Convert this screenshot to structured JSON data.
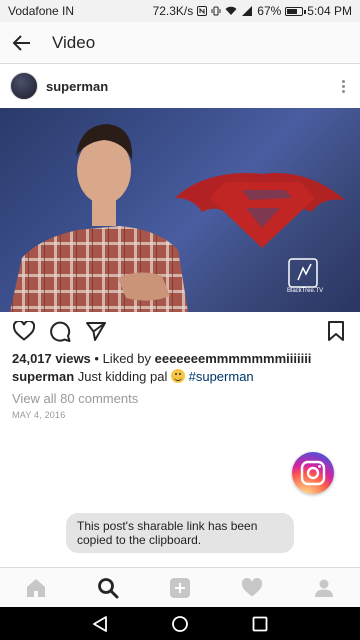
{
  "status_bar": {
    "carrier": "Vodafone IN",
    "network_speed": "72.3K/s",
    "battery_percent": "67%",
    "battery_level": 0.67,
    "time": "5:04 PM"
  },
  "app_bar": {
    "title": "Video"
  },
  "post": {
    "username": "superman",
    "views": "24,017 views",
    "liked_by_prefix": " • Liked by ",
    "liked_by_user": "eeeeeeemmmmmmmiiiiiii",
    "caption_user": "superman",
    "caption_text": " Just kidding pal ",
    "hashtag": "#superman",
    "view_comments": "View all 80 comments",
    "date": "MAY 4, 2016",
    "watermark": "BlackTree.TV"
  },
  "toast": {
    "message": "This post's sharable link has been copied to the clipboard."
  },
  "icons": {
    "back": "arrow-left-icon",
    "more": "more-vertical-icon",
    "like": "heart-icon",
    "comment": "comment-icon",
    "share": "send-icon",
    "save": "bookmark-icon",
    "instagram": "instagram-icon"
  },
  "tabbar": {
    "items": [
      "home",
      "search",
      "add",
      "activity",
      "profile"
    ],
    "active": "search"
  },
  "colors": {
    "hashtag": "#003569",
    "muted": "#999999",
    "toast_bg": "#e4e4e4"
  }
}
